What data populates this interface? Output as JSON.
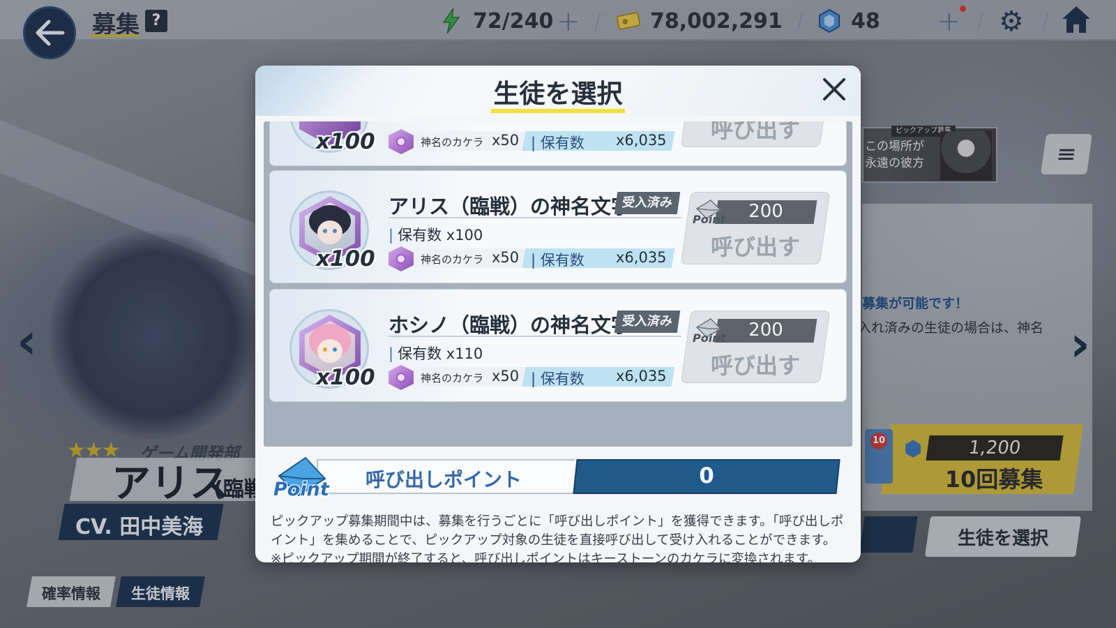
{
  "header": {
    "title": "募集",
    "help": "?",
    "stamina": "72/240",
    "credits": "78,002,291",
    "gems": "48"
  },
  "background": {
    "banner_text": "この場所が永遠の彼方",
    "banner_tag": "ピックアップ募集",
    "notice_line1": "募集が可能です！",
    "notice_line2": "入れ済みの生徒の場合は、神名",
    "gacha_cost": "1,200",
    "gacha_label": "10回募集",
    "envelope_count": "10",
    "select_button": "生徒を選択",
    "stars": "★★★",
    "school": "ゲーム開発部",
    "char_name": "アリス",
    "char_suffix": "(臨戦",
    "cv": "CV. 田中美海",
    "tab_rates": "確率情報",
    "tab_student": "生徒情報"
  },
  "modal": {
    "title": "生徒を選択",
    "items": [
      {
        "name": "",
        "status": "",
        "owned_label": "",
        "owned_value": "",
        "multiplier": "x100",
        "cost_item": "神名のカケラ",
        "cost_qty": "x50",
        "have_label": "保有数",
        "have_value": "x6,035",
        "point_cost": "",
        "call_label": "呼び出す"
      },
      {
        "name": "アリス（臨戦）の神名文字",
        "status": "受入済み",
        "owned_label": "保有数",
        "owned_value": "x100",
        "multiplier": "x100",
        "cost_item": "神名のカケラ",
        "cost_qty": "x50",
        "have_label": "保有数",
        "have_value": "x6,035",
        "point_cost": "200",
        "call_label": "呼び出す"
      },
      {
        "name": "ホシノ（臨戦）の神名文字",
        "status": "受入済み",
        "owned_label": "保有数",
        "owned_value": "x110",
        "multiplier": "x100",
        "cost_item": "神名のカケラ",
        "cost_qty": "x50",
        "have_label": "保有数",
        "have_value": "x6,035",
        "point_cost": "200",
        "call_label": "呼び出す"
      }
    ],
    "points_label": "呼び出しポイント",
    "points_value": "0",
    "point_badge": "Point",
    "desc_line1": "ピックアップ募集期間中は、募集を行うごとに「呼び出しポイント」を獲得できます。「呼び出しポイント」を集めることで、ピックアップ対象の生徒を直接呼び出して受け入れることができます。",
    "desc_line2": "※ピックアップ期間が終了すると、呼び出しポイントはキーストーンのカケラに変換されます。"
  },
  "colors": {
    "accent_yellow": "#f2df3b",
    "navy": "#1f5a8a",
    "gem_purple": "#8a4fb8"
  }
}
